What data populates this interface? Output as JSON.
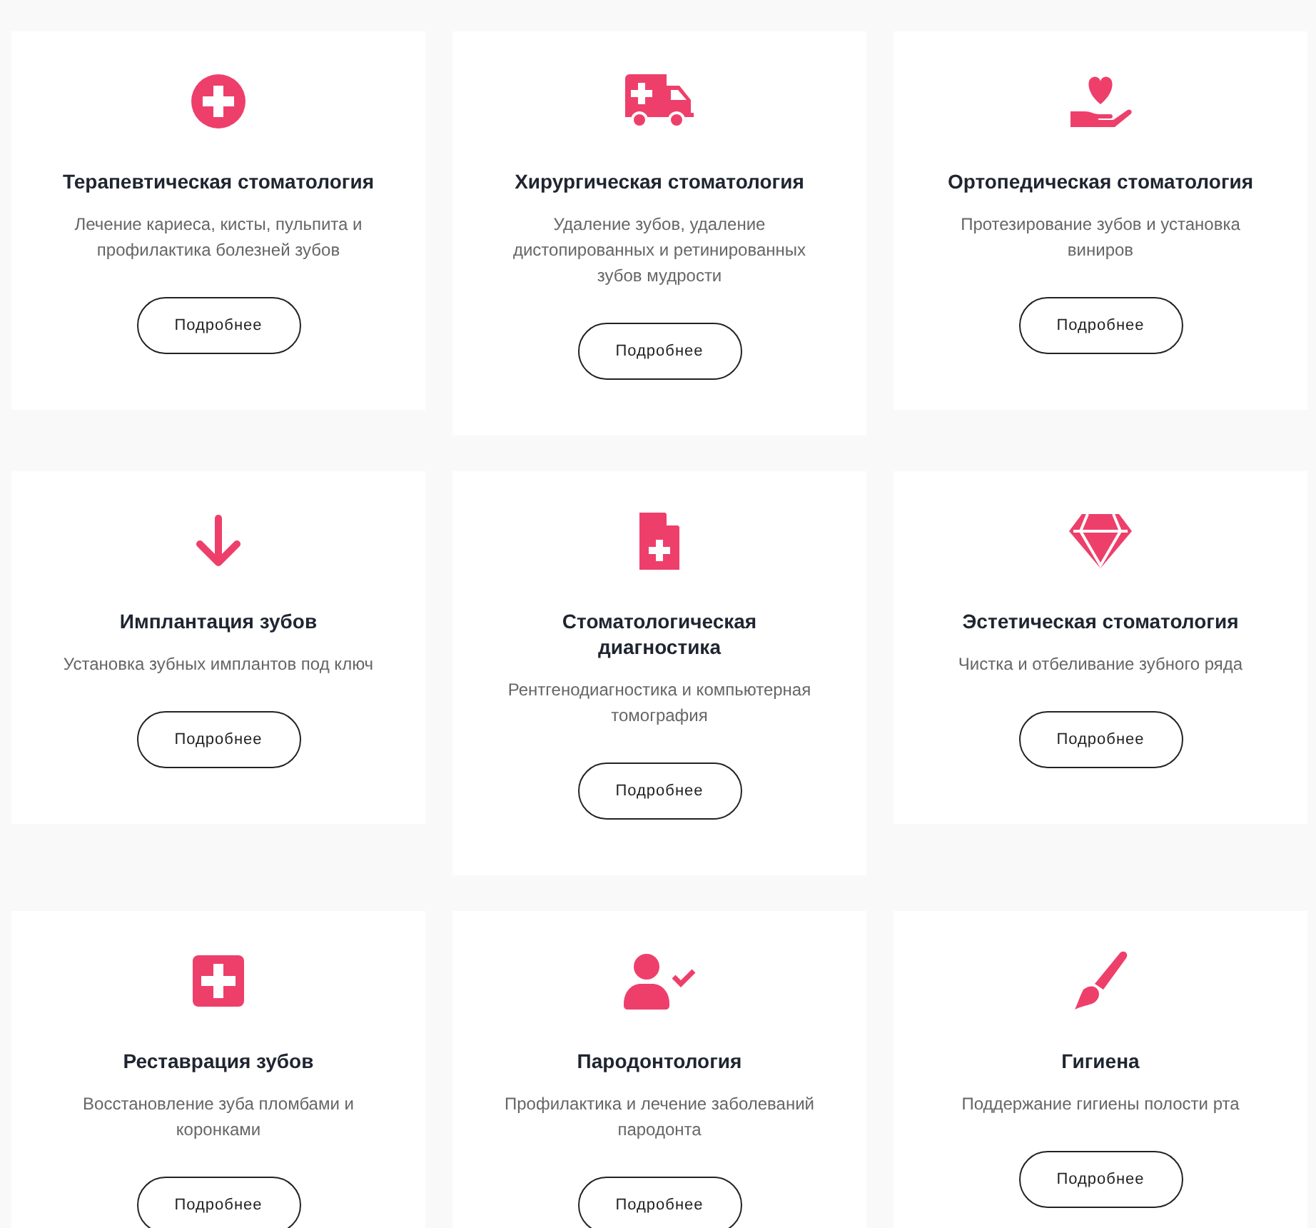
{
  "services": [
    {
      "title": "Терапевтическая стоматология",
      "description": "Лечение кариеса, кисты, пульпита и профилактика болезней зубов",
      "button": "Подробнее"
    },
    {
      "title": "Хирургическая стоматология",
      "description": "Удаление зубов, удаление дистопированных и ретинированных зубов мудрости",
      "button": "Подробнее"
    },
    {
      "title": "Ортопедическая стоматология",
      "description": "Протезирование зубов и установка виниров",
      "button": "Подробнее"
    },
    {
      "title": "Имплантация зубов",
      "description": "Установка зубных имплантов под ключ",
      "button": "Подробнее"
    },
    {
      "title": "Стоматологическая диагностика",
      "description": "Рентгенодиагностика и компьютерная томография",
      "button": "Подробнее"
    },
    {
      "title": "Эстетическая стоматология",
      "description": "Чистка и отбеливание зубного ряда",
      "button": "Подробнее"
    },
    {
      "title": "Реставрация зубов",
      "description": "Восстановление зуба пломбами и коронками",
      "button": "Подробнее"
    },
    {
      "title": "Пародонтология",
      "description": "Профилактика и лечение заболеваний пародонта",
      "button": "Подробнее"
    },
    {
      "title": "Гигиена",
      "description": "Поддержание гигиены полости рта",
      "button": "Подробнее"
    }
  ]
}
